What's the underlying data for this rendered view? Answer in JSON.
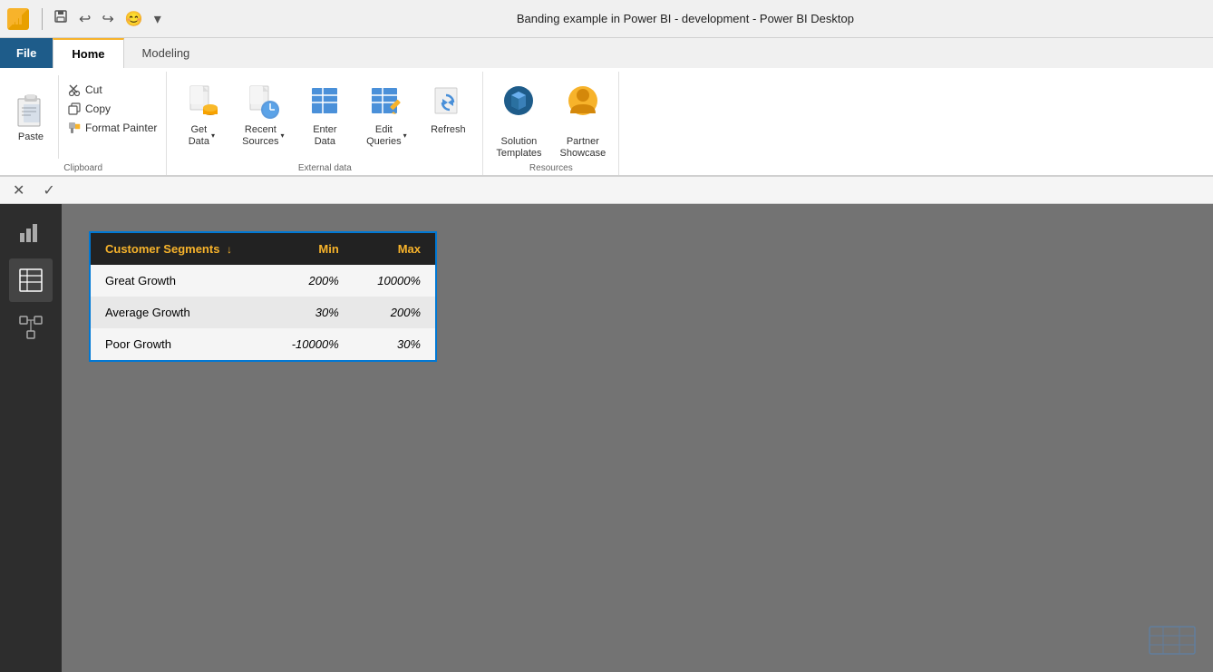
{
  "titlebar": {
    "title": "Banding example in Power BI - development - Power BI Desktop",
    "quickaccess": {
      "save_tooltip": "Save",
      "undo_tooltip": "Undo",
      "redo_tooltip": "Redo",
      "emoji_tooltip": "Emoji",
      "more_tooltip": "More"
    }
  },
  "ribbon": {
    "tabs": [
      {
        "id": "file",
        "label": "File",
        "active": false,
        "style": "file"
      },
      {
        "id": "home",
        "label": "Home",
        "active": true,
        "style": "normal"
      },
      {
        "id": "modeling",
        "label": "Modeling",
        "active": false,
        "style": "normal"
      }
    ],
    "clipboard": {
      "group_label": "Clipboard",
      "paste_label": "Paste",
      "cut_label": "Cut",
      "copy_label": "Copy",
      "format_painter_label": "Format Painter"
    },
    "external_data": {
      "group_label": "External data",
      "get_data_label": "Get\nData",
      "recent_sources_label": "Recent\nSources",
      "enter_data_label": "Enter\nData",
      "edit_queries_label": "Edit\nQueries",
      "refresh_label": "Refresh"
    },
    "resources": {
      "group_label": "Resources",
      "solution_templates_label": "Solution\nTemplates",
      "partner_showcase_label": "Partner\nShowcase"
    }
  },
  "formula_bar": {
    "cancel_label": "✕",
    "confirm_label": "✓"
  },
  "sidebar": {
    "items": [
      {
        "id": "report",
        "icon": "chart-bar",
        "active": false
      },
      {
        "id": "data",
        "icon": "table",
        "active": true
      },
      {
        "id": "model",
        "icon": "model",
        "active": false
      }
    ]
  },
  "table": {
    "columns": [
      {
        "id": "customer_segments",
        "label": "Customer Segments",
        "has_sort": true
      },
      {
        "id": "min",
        "label": "Min",
        "numeric": true
      },
      {
        "id": "max",
        "label": "Max",
        "numeric": true
      }
    ],
    "rows": [
      {
        "customer_segments": "Great Growth",
        "min": "200%",
        "max": "10000%"
      },
      {
        "customer_segments": "Average Growth",
        "min": "30%",
        "max": "200%"
      },
      {
        "customer_segments": "Poor Growth",
        "min": "-10000%",
        "max": "30%"
      }
    ]
  }
}
